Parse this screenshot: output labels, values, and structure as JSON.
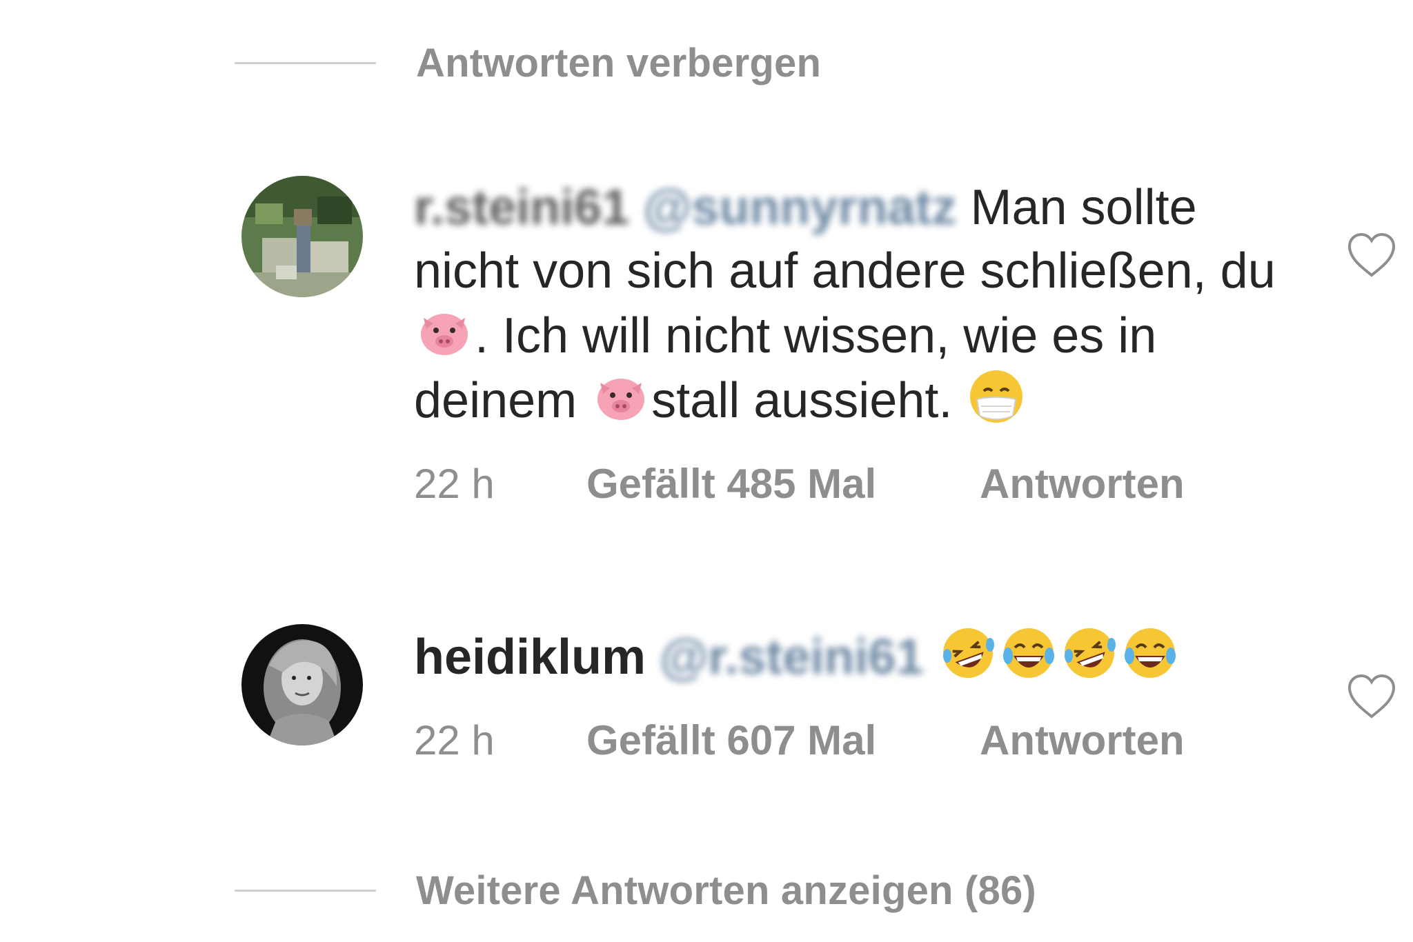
{
  "thread": {
    "hide_replies_label": "Antworten verbergen",
    "more_replies_label": "Weitere Antworten anzeigen (86)"
  },
  "comments": [
    {
      "username": "r.steini61",
      "mention": "@sunnyrnatz",
      "text_part_1": " Man sollte nicht von sich auf andere schließen, du ",
      "text_part_2": ". Ich will nicht wissen, wie es in deinem ",
      "text_part_3": "stall aussieht. ",
      "emojis": [
        "pig-face-emoji",
        "pig-face-emoji",
        "face-with-medical-mask-emoji"
      ],
      "time": "22 h",
      "likes_label": "Gefällt 485 Mal",
      "reply_label": "Antworten"
    },
    {
      "username": "heidiklum",
      "mention": "@r.steini61",
      "emojis": [
        "rolling-on-floor-laughing-emoji",
        "face-with-tears-of-joy-emoji",
        "rolling-on-floor-laughing-emoji",
        "face-with-tears-of-joy-emoji"
      ],
      "time": "22 h",
      "likes_label": "Gefällt 607 Mal",
      "reply_label": "Antworten"
    }
  ],
  "icons": {
    "like": "heart-outline-icon"
  },
  "colors": {
    "text": "#262626",
    "secondary": "#8e8e8e",
    "mention": "#3b5f84",
    "divider": "#cfcfcf"
  }
}
